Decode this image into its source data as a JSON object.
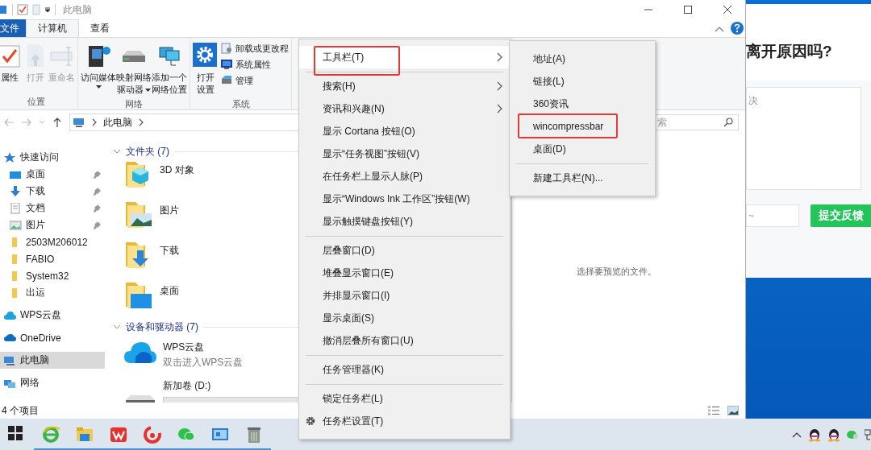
{
  "explorer": {
    "title": "此电脑",
    "ribbon_tabs": [
      {
        "label": "文件",
        "kind": "file",
        "selected": false
      },
      {
        "label": "计算机",
        "kind": "tab",
        "selected": true
      },
      {
        "label": "查看",
        "kind": "tab",
        "selected": false
      }
    ],
    "ribbon_groups": [
      {
        "label": "位置",
        "buttons": [
          {
            "lines": [
              "属性"
            ],
            "kind": "large",
            "disabled": false
          },
          {
            "lines": [
              "打开"
            ],
            "kind": "large",
            "disabled": true
          },
          {
            "lines": [
              "重命名"
            ],
            "kind": "large",
            "disabled": true
          }
        ]
      },
      {
        "label": "网络",
        "buttons": [
          {
            "lines": [
              "访问媒体"
            ],
            "kind": "large",
            "dropdown": true
          },
          {
            "lines": [
              "映射网络",
              "驱动器"
            ],
            "kind": "large",
            "dropdown": true
          },
          {
            "lines": [
              "添加一个",
              "网络位置"
            ],
            "kind": "large",
            "dropdown": false
          }
        ]
      },
      {
        "label": "系统",
        "buttons": [
          {
            "lines": [
              "打开",
              "设置"
            ],
            "kind": "large"
          },
          {
            "label": "卸载或更改程",
            "kind": "small"
          },
          {
            "label": "系统属性",
            "kind": "small"
          },
          {
            "label": "管理",
            "kind": "small"
          }
        ]
      }
    ],
    "address": {
      "path": "此电脑",
      "search_placeholder": "索"
    },
    "nav": [
      {
        "label": "快速访问",
        "kind": "header",
        "pinned": false,
        "selected": false
      },
      {
        "label": "桌面",
        "kind": "child",
        "pinned": true,
        "selected": false
      },
      {
        "label": "下载",
        "kind": "child",
        "pinned": true,
        "selected": false
      },
      {
        "label": "文档",
        "kind": "child",
        "pinned": true,
        "selected": false
      },
      {
        "label": "图片",
        "kind": "child",
        "pinned": true,
        "selected": false
      },
      {
        "label": "2503M206012",
        "kind": "child",
        "pinned": false,
        "selected": false
      },
      {
        "label": "FABIO",
        "kind": "child",
        "pinned": false,
        "selected": false
      },
      {
        "label": "System32",
        "kind": "child",
        "pinned": false,
        "selected": false
      },
      {
        "label": "出运",
        "kind": "child",
        "pinned": false,
        "selected": false
      },
      {
        "label": "WPS云盘",
        "kind": "header",
        "pinned": false,
        "selected": false
      },
      {
        "label": "OneDrive",
        "kind": "header",
        "pinned": false,
        "selected": false
      },
      {
        "label": "此电脑",
        "kind": "header",
        "pinned": false,
        "selected": true
      },
      {
        "label": "网络",
        "kind": "header",
        "pinned": false,
        "selected": false
      }
    ],
    "sections": [
      {
        "title": "文件夹 (7)",
        "expanded": true,
        "items": [
          {
            "label": "3D 对象",
            "kind": "folder"
          },
          {
            "label": "图片",
            "kind": "folder"
          },
          {
            "label": "下载",
            "kind": "folder"
          },
          {
            "label": "桌面",
            "kind": "folder"
          }
        ]
      },
      {
        "title": "设备和驱动器 (7)",
        "expanded": true,
        "items": [
          {
            "label": "WPS云盘",
            "subtitle": "双击进入WPS云盘",
            "kind": "cloud"
          },
          {
            "label": "新加卷 (D:)",
            "kind": "drive"
          }
        ]
      }
    ],
    "preview_message": "选择要预览的文件。",
    "status": "4 个项目"
  },
  "feedback": {
    "title": "离开原因吗?",
    "textarea_placeholder": "决",
    "input_placeholder": "~",
    "submit": "提交反馈"
  },
  "context_menu": {
    "sections": [
      {
        "items": [
          {
            "label": "工具栏(T)",
            "kind": "submenu",
            "highlighted": true,
            "annotated": true
          }
        ]
      },
      {
        "items": [
          {
            "label": "搜索(H)",
            "kind": "submenu",
            "highlighted": false,
            "annotated": false
          },
          {
            "label": "资讯和兴趣(N)",
            "kind": "submenu",
            "highlighted": false,
            "annotated": false
          },
          {
            "label": "显示 Cortana 按钮(O)",
            "kind": "plain",
            "highlighted": false,
            "annotated": false
          },
          {
            "label": "显示“任务视图”按钮(V)",
            "kind": "plain",
            "highlighted": false,
            "annotated": false
          },
          {
            "label": "在任务栏上显示人脉(P)",
            "kind": "plain",
            "highlighted": false,
            "annotated": false
          },
          {
            "label": "显示“Windows Ink 工作区”按钮(W)",
            "kind": "plain",
            "highlighted": false,
            "annotated": false
          },
          {
            "label": "显示触摸键盘按钮(Y)",
            "kind": "plain",
            "highlighted": false,
            "annotated": false
          }
        ]
      },
      {
        "items": [
          {
            "label": "层叠窗口(D)",
            "kind": "plain",
            "highlighted": false,
            "annotated": false
          },
          {
            "label": "堆叠显示窗口(E)",
            "kind": "plain",
            "highlighted": false,
            "annotated": false
          },
          {
            "label": "并排显示窗口(I)",
            "kind": "plain",
            "highlighted": false,
            "annotated": false
          },
          {
            "label": "显示桌面(S)",
            "kind": "plain",
            "highlighted": false,
            "annotated": false
          },
          {
            "label": "撤消层叠所有窗口(U)",
            "kind": "plain",
            "highlighted": false,
            "annotated": false
          }
        ]
      },
      {
        "items": [
          {
            "label": "任务管理器(K)",
            "kind": "plain",
            "highlighted": false,
            "annotated": false
          }
        ]
      },
      {
        "items": [
          {
            "label": "锁定任务栏(L)",
            "kind": "plain",
            "highlighted": false,
            "annotated": false
          },
          {
            "label": "任务栏设置(T)",
            "kind": "settings",
            "highlighted": false,
            "annotated": false
          }
        ]
      }
    ]
  },
  "submenu": {
    "sections": [
      {
        "items": [
          {
            "label": "地址(A)",
            "annotated": false
          },
          {
            "label": "链接(L)",
            "annotated": false
          },
          {
            "label": "360资讯",
            "annotated": false
          },
          {
            "label": "wincompressbar",
            "annotated": true
          },
          {
            "label": "桌面(D)",
            "annotated": false
          }
        ]
      },
      {
        "items": [
          {
            "label": "新建工具栏(N)...",
            "annotated": false
          }
        ]
      }
    ]
  }
}
